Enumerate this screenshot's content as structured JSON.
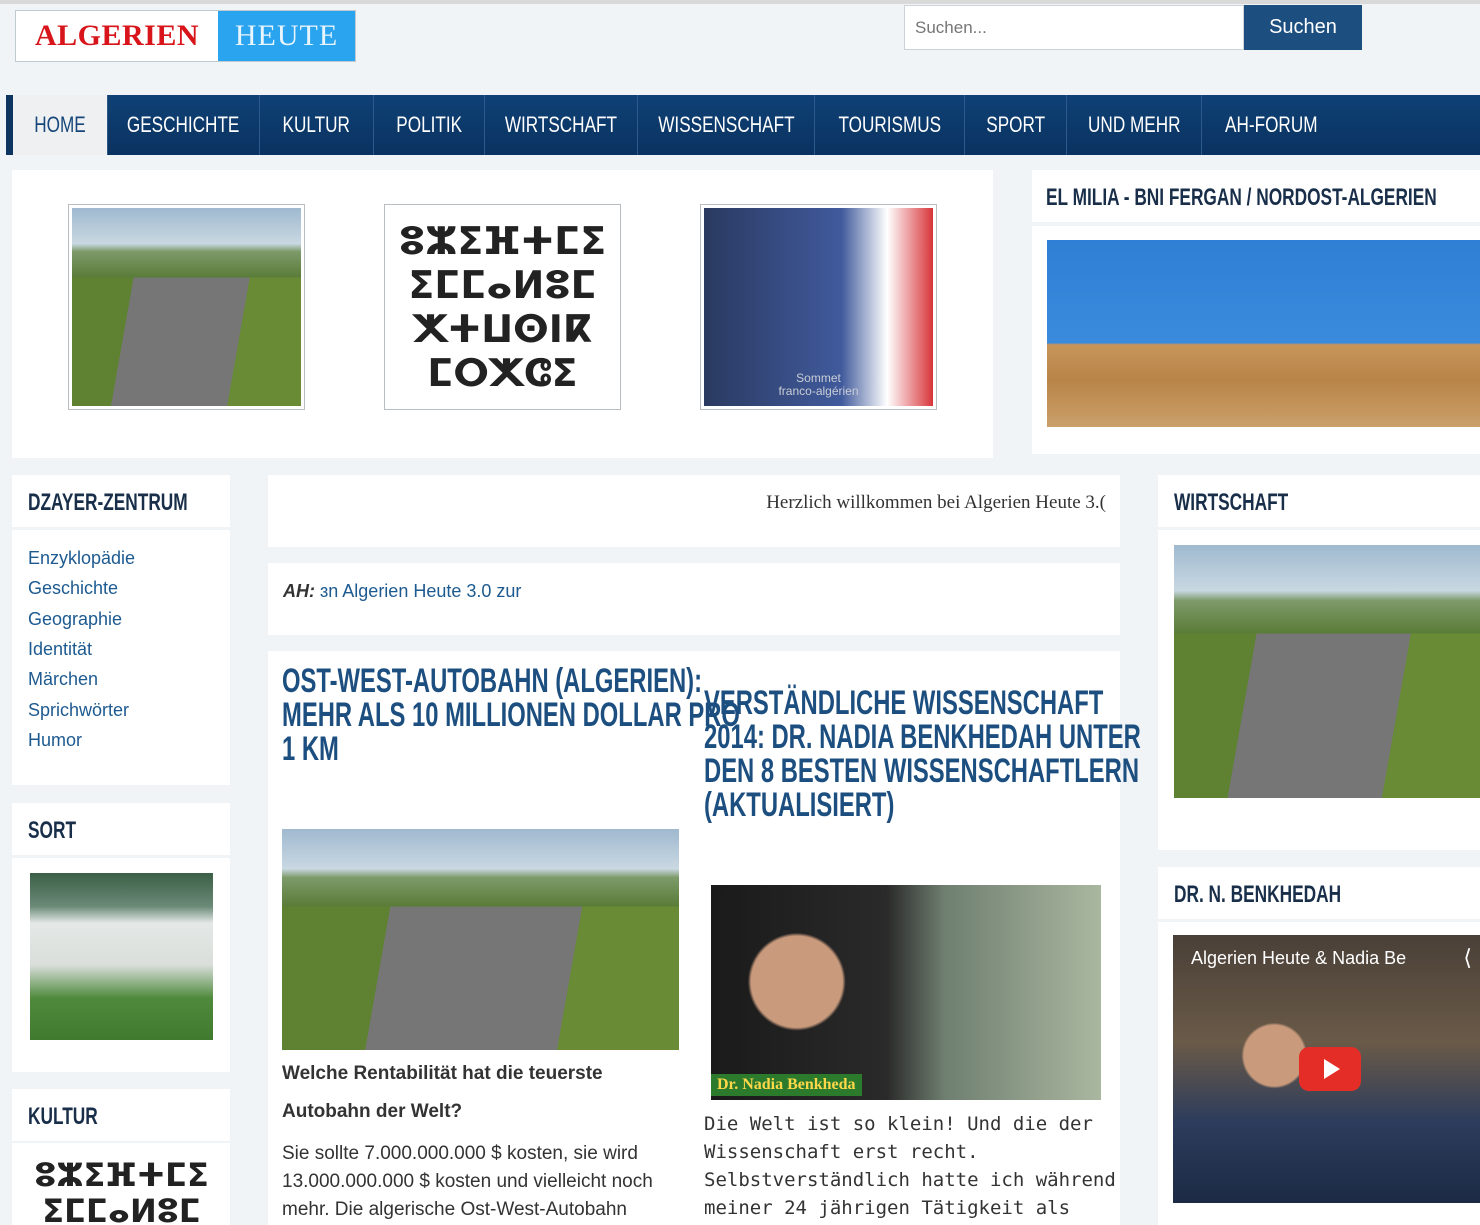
{
  "header": {
    "logo_part1": "ALGERIEN",
    "logo_part2": "HEUTE",
    "search_placeholder": "Suchen...",
    "search_button": "Suchen"
  },
  "nav": {
    "items": [
      "HOME",
      "GESCHICHTE",
      "KULTUR",
      "POLITIK",
      "WIRTSCHAFT",
      "WISSENSCHAFT",
      "TOURISMUS",
      "SPORT",
      "UND MEHR",
      "AH-FORUM"
    ],
    "active": "HOME"
  },
  "slider": {
    "tifinagh_lines": [
      "ⵓⵣⵉⴼⵜⵎⵉ",
      "ⵉⵎⵎⴰⵍⵓⵎ",
      "ⵅⵜⵡⵙⵏⴽ",
      "ⵎⵔⵅⵛⵉ"
    ],
    "politic_caption_1": "Sommet",
    "politic_caption_2": "franco-algérien"
  },
  "el_milia": {
    "title": "EL MILIA - BNI FERGAN / NORDOST-ALGERIEN"
  },
  "dzayer": {
    "title": "DZAYER-ZENTRUM",
    "links": [
      "Enzyklopädie",
      "Geschichte",
      "Geographie",
      "Identität",
      "Märchen",
      "Sprichwörter",
      "Humor"
    ]
  },
  "sort": {
    "title": "SORT"
  },
  "kultur": {
    "title": "KULTUR",
    "tifinagh_lines": [
      "ⵓⵣⵉⴼⵜⵎⵉ",
      "ⵉⵎⵎⴰⵍⵓⵎ"
    ]
  },
  "ticker": {
    "text": "Herzlich willkommen bei Algerien Heute 3.(",
    "ah_label": "AH:",
    "ah_text": "ɜn Algerien Heute 3.0 zur"
  },
  "article1": {
    "title_lines": [
      "OST-WEST-AUTOBAHN (ALGERIEN):",
      "MEHR ALS 10 MILLIONEN DOLLAR PRO",
      "1 KM"
    ],
    "subtitle_lines": [
      "Welche Rentabilität hat die teuerste",
      "Autobahn der Welt?"
    ],
    "body_lines": [
      "Sie sollte 7.000.000.000 $ kosten, sie wird",
      "13.000.000.000 $ kosten und vielleicht noch",
      "mehr. Die algerische Ost-West-Autobahn"
    ]
  },
  "article2": {
    "title_lines": [
      "VERSTÄNDLICHE WISSENSCHAFT",
      "2014: DR. NADIA BENKHEDAH UNTER",
      "DEN 8 BESTEN WISSENSCHAFTLERN",
      "(AKTUALISIERT)"
    ],
    "image_caption": "Dr. Nadia Benkheda",
    "body_lines": [
      "Die Welt ist so klein! Und die der",
      "Wissenschaft erst recht.",
      "Selbstverständlich hatte ich während",
      "meiner 24 jährigen Tätigkeit als"
    ]
  },
  "wirtschaft": {
    "title": "WIRTSCHAFT"
  },
  "benkhedah": {
    "title": "DR. N. BENKHEDAH",
    "video_title": "Algerien Heute & Nadia Be"
  },
  "colors": {
    "nav_bg": "#0f4176",
    "accent": "#1c4f80",
    "logo_red": "#d8151b",
    "logo_blue": "#2aa4ee"
  }
}
